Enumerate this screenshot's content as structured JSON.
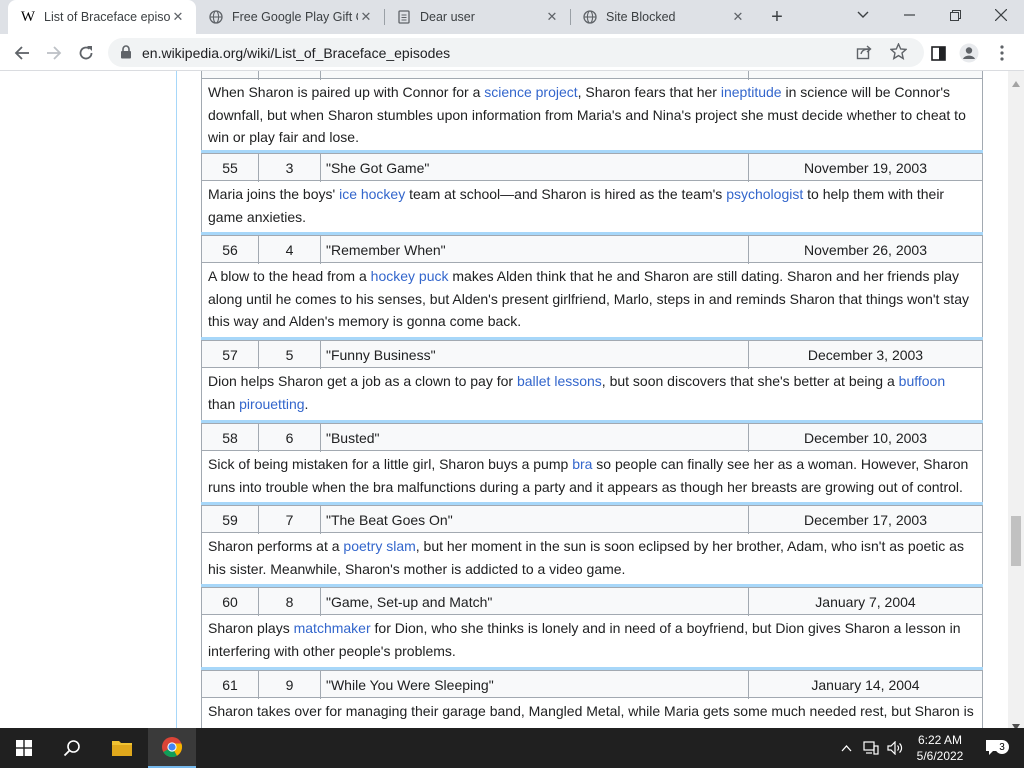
{
  "browser": {
    "tabs": [
      {
        "title": "List of Braceface episo",
        "favicon": "W",
        "active": true
      },
      {
        "title": "Free Google Play Gift C",
        "active": false
      },
      {
        "title": "Dear user",
        "active": false
      },
      {
        "title": "Site Blocked",
        "active": false
      }
    ],
    "url": "en.wikipedia.org/wiki/List_of_Braceface_episodes"
  },
  "episodes": [
    {
      "desc_pre": "When Sharon is paired up with Connor for a ",
      "link1": "science project",
      "mid1": ", Sharon fears that her ",
      "link2": "ineptitude",
      "desc_post": " in science will be Connor's downfall, but when Sharon stumbles upon information from Maria's and Nina's project she must decide whether to cheat to win or play fair and lose."
    },
    {
      "num": "55",
      "season_num": "3",
      "title": "\"She Got Game\"",
      "date": "November 19, 2003",
      "desc_pre": "Maria joins the boys' ",
      "link1": "ice hockey",
      "mid1": " team at school—and Sharon is hired as the team's ",
      "link2": "psychologist",
      "desc_post": " to help them with their game anxieties."
    },
    {
      "num": "56",
      "season_num": "4",
      "title": "\"Remember When\"",
      "date": "November 26, 2003",
      "desc_pre": "A blow to the head from a ",
      "link1": "hockey puck",
      "desc_post": " makes Alden think that he and Sharon are still dating. Sharon and her friends play along until he comes to his senses, but Alden's present girlfriend, Marlo, steps in and reminds Sharon that things won't stay this way and Alden's memory is gonna come back."
    },
    {
      "num": "57",
      "season_num": "5",
      "title": "\"Funny Business\"",
      "date": "December 3, 2003",
      "desc_pre": "Dion helps Sharon get a job as a clown to pay for ",
      "link1": "ballet lessons",
      "mid1": ", but soon discovers that she's better at being a ",
      "link2": "buffoon",
      "mid2": " than ",
      "link3": "pirouetting",
      "desc_post": "."
    },
    {
      "num": "58",
      "season_num": "6",
      "title": "\"Busted\"",
      "date": "December 10, 2003",
      "desc_pre": "Sick of being mistaken for a little girl, Sharon buys a pump ",
      "link1": "bra",
      "desc_post": " so people can finally see her as a woman. However, Sharon runs into trouble when the bra malfunctions during a party and it appears as though her breasts are growing out of control."
    },
    {
      "num": "59",
      "season_num": "7",
      "title": "\"The Beat Goes On\"",
      "date": "December 17, 2003",
      "desc_pre": "Sharon performs at a ",
      "link1": "poetry slam",
      "desc_post": ", but her moment in the sun is soon eclipsed by her brother, Adam, who isn't as poetic as his sister. Meanwhile, Sharon's mother is addicted to a video game."
    },
    {
      "num": "60",
      "season_num": "8",
      "title": "\"Game, Set-up and Match\"",
      "date": "January 7, 2004",
      "desc_pre": "Sharon plays ",
      "link1": "matchmaker",
      "desc_post": " for Dion, who she thinks is lonely and in need of a boyfriend, but Dion gives Sharon a lesson in interfering with other people's problems."
    },
    {
      "num": "61",
      "season_num": "9",
      "title": "\"While You Were Sleeping\"",
      "date": "January 14, 2004",
      "desc_pre": "Sharon takes over for managing their garage band, Mangled Metal, while Maria gets some much needed rest, but Sharon is"
    }
  ],
  "taskbar": {
    "time": "6:22 AM",
    "date": "5/6/2022",
    "notifications": "3"
  },
  "colors": {
    "link": "#3366cc",
    "accent_rule": "#a7d7f9",
    "border": "#a2a9b1"
  }
}
